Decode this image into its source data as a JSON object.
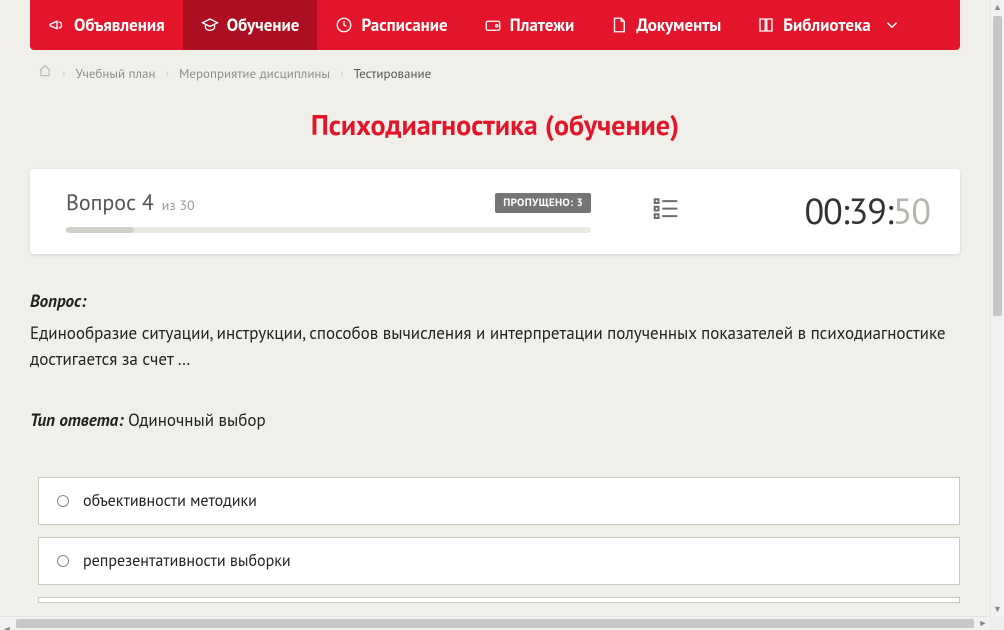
{
  "nav": {
    "items": [
      {
        "label": "Объявления",
        "icon": "megaphone",
        "active": false
      },
      {
        "label": "Обучение",
        "icon": "graduation-cap",
        "active": true
      },
      {
        "label": "Расписание",
        "icon": "clock",
        "active": false
      },
      {
        "label": "Платежи",
        "icon": "wallet",
        "active": false
      },
      {
        "label": "Документы",
        "icon": "file",
        "active": false
      },
      {
        "label": "Библиотека",
        "icon": "book",
        "active": false,
        "dropdown": true
      }
    ]
  },
  "breadcrumbs": {
    "items": [
      {
        "label": "Учебный план",
        "current": false
      },
      {
        "label": "Мероприятие дисциплины",
        "current": false
      },
      {
        "label": "Тестирование",
        "current": true
      }
    ]
  },
  "page_title": "Психодиагностика (обучение)",
  "question_header": {
    "label_prefix": "Вопрос",
    "number": "4",
    "of_prefix": "из",
    "total": "30",
    "skipped_label": "ПРОПУЩЕНО:",
    "skipped_count": "3",
    "progress_percent": 13
  },
  "timer": {
    "min": "00",
    "sec_main": "39",
    "sec_tail": "50"
  },
  "question": {
    "heading": "Вопрос:",
    "text": "Единообразие ситуации, инструкции, способов вычисления и интерпретации полученных показателей в психодиагностике достигается за счет …",
    "answer_type_label": "Тип ответа:",
    "answer_type_value": "Одиночный выбор"
  },
  "options": [
    {
      "text": "объективности методики"
    },
    {
      "text": "репрезентативности выборки"
    }
  ]
}
